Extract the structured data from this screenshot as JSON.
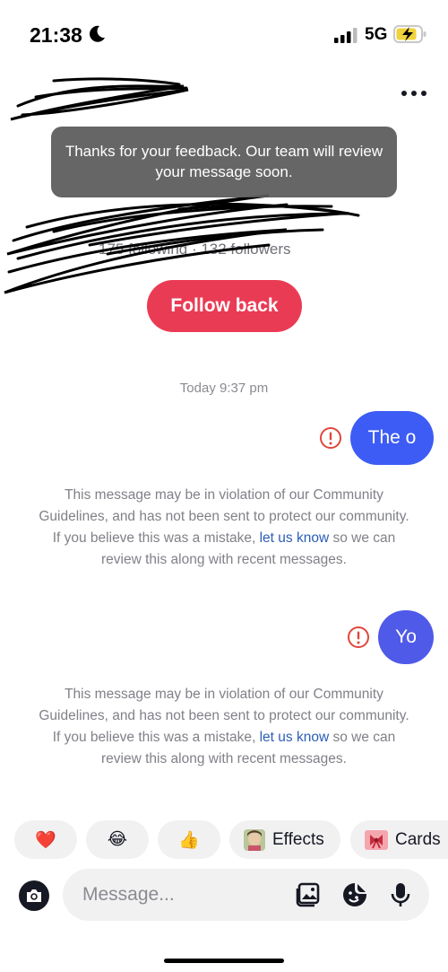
{
  "status_bar": {
    "time": "21:38",
    "network": "5G"
  },
  "toast": {
    "text": "Thanks for your feedback. Our team will review your message soon."
  },
  "profile": {
    "name": "",
    "stats": "175 following · 132 followers",
    "follow_label": "Follow back"
  },
  "chat": {
    "timestamp": "Today 9:37 pm",
    "messages": [
      {
        "text": "The o",
        "warning_before": "This message may be in violation of our Community Guidelines, and has not been sent to protect our community. If you believe this was a mistake, ",
        "warning_link": "let us know",
        "warning_after": " so we can review this along with recent messages."
      },
      {
        "text": "Yo",
        "warning_before": "This message may be in violation of our Community Guidelines, and has not been sent to protect our community. If you believe this was a mistake, ",
        "warning_link": "let us know",
        "warning_after": " so we can review this along with recent messages."
      }
    ]
  },
  "quick_replies": {
    "heart": "❤️",
    "laugh": "😂",
    "thumb": "👍",
    "effects": "Effects",
    "cards": "Cards"
  },
  "composer": {
    "placeholder": "Message..."
  },
  "colors": {
    "accent": "#ea3b55",
    "bubble": "#3d5cf5",
    "error": "#e0463c",
    "link": "#2b5db8"
  }
}
